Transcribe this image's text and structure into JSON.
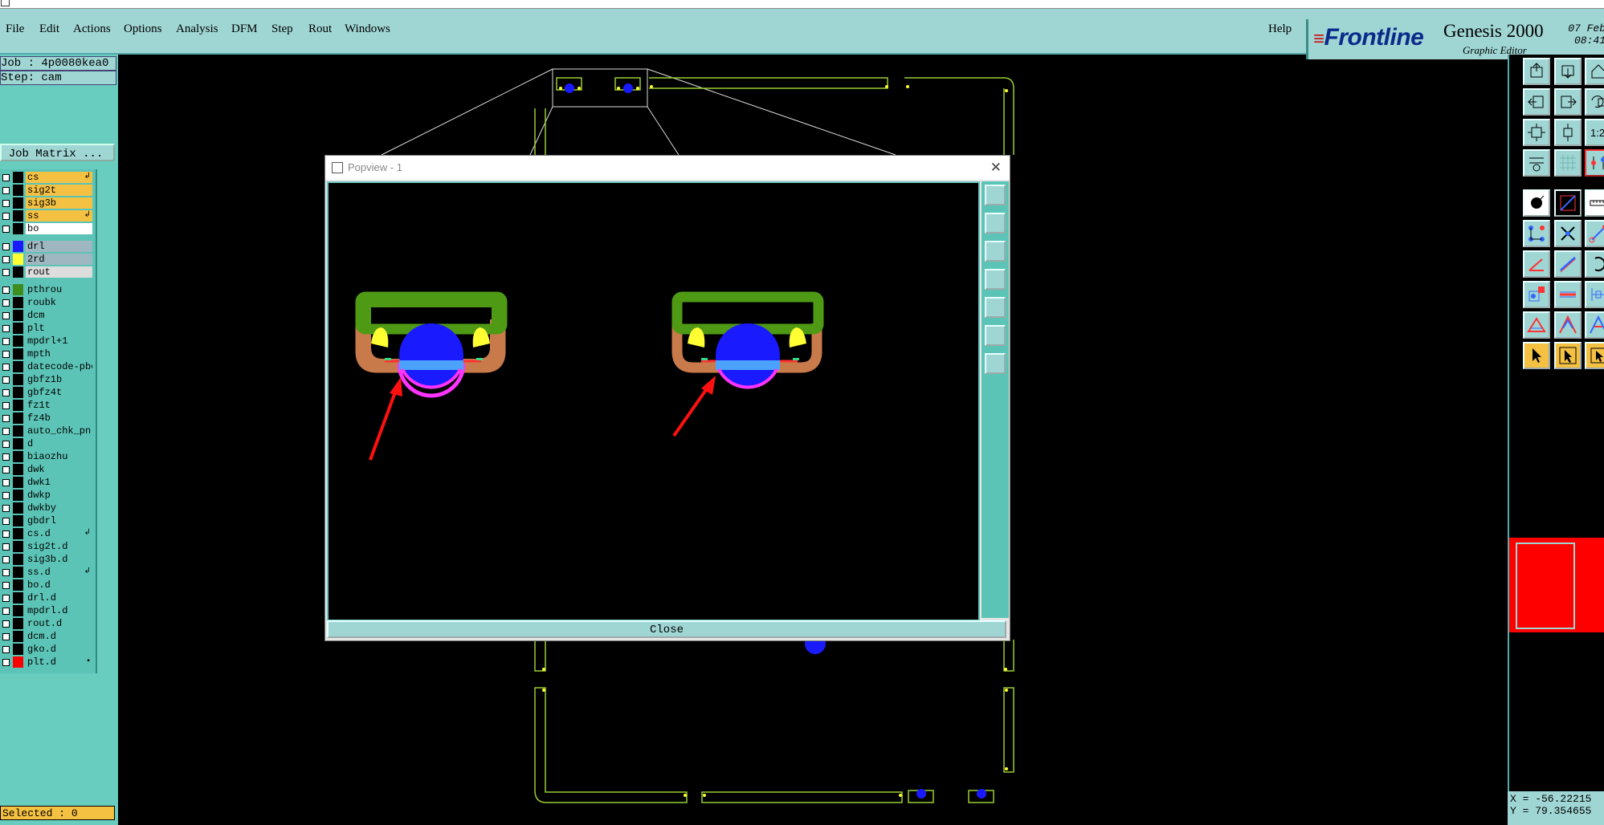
{
  "menu": {
    "items": [
      "File",
      "Edit",
      "Actions",
      "Options",
      "Analysis",
      "DFM",
      "Step",
      "Rout",
      "Windows"
    ],
    "help": "Help"
  },
  "brand": {
    "logo": "Frontline",
    "product": "Genesis 2000",
    "subtitle": "Graphic Editor",
    "date": "07 Feb",
    "time": "08:41"
  },
  "info": {
    "job": "Job : 4p0080kea0",
    "step": "Step: cam",
    "job_matrix": "Job Matrix ..."
  },
  "layers": [
    {
      "name": "cs",
      "swatch": "#000000",
      "label_bg": "#f5c143",
      "mark": "↲"
    },
    {
      "name": "sig2t",
      "swatch": "#000000",
      "label_bg": "#f5c143",
      "mark": ""
    },
    {
      "name": "sig3b",
      "swatch": "#000000",
      "label_bg": "#f5c143",
      "mark": ""
    },
    {
      "name": "ss",
      "swatch": "#000000",
      "label_bg": "#f5c143",
      "mark": "↲"
    },
    {
      "name": "bo",
      "swatch": "#000000",
      "label_bg": "#ffffff",
      "mark": ""
    },
    {
      "name": "drl",
      "swatch": "#1a1aff",
      "label_bg": "#9fb7c0",
      "mark": ""
    },
    {
      "name": "2rd",
      "swatch": "#ffff33",
      "label_bg": "#9fb7c0",
      "mark": ""
    },
    {
      "name": "rout",
      "swatch": "#000000",
      "label_bg": "#dddddd",
      "mark": ""
    },
    {
      "name": "pthrou",
      "swatch": "#3d8c1e",
      "label_bg": "#5cc4b7",
      "mark": ""
    },
    {
      "name": "roubk",
      "swatch": "#000000",
      "label_bg": "#5cc4b7",
      "mark": ""
    },
    {
      "name": "dcm",
      "swatch": "#000000",
      "label_bg": "#5cc4b7",
      "mark": ""
    },
    {
      "name": "plt",
      "swatch": "#000000",
      "label_bg": "#5cc4b7",
      "mark": ""
    },
    {
      "name": "mpdrl+1",
      "swatch": "#000000",
      "label_bg": "#5cc4b7",
      "mark": ""
    },
    {
      "name": "mpth",
      "swatch": "#000000",
      "label_bg": "#5cc4b7",
      "mark": ""
    },
    {
      "name": "datecode-pbe",
      "swatch": "#000000",
      "label_bg": "#5cc4b7",
      "mark": ""
    },
    {
      "name": "gbfz1b",
      "swatch": "#000000",
      "label_bg": "#5cc4b7",
      "mark": ""
    },
    {
      "name": "gbfz4t",
      "swatch": "#000000",
      "label_bg": "#5cc4b7",
      "mark": ""
    },
    {
      "name": "fz1t",
      "swatch": "#000000",
      "label_bg": "#5cc4b7",
      "mark": ""
    },
    {
      "name": "fz4b",
      "swatch": "#000000",
      "label_bg": "#5cc4b7",
      "mark": ""
    },
    {
      "name": "auto_chk_pn",
      "swatch": "#000000",
      "label_bg": "#5cc4b7",
      "mark": ""
    },
    {
      "name": "d",
      "swatch": "#000000",
      "label_bg": "#5cc4b7",
      "mark": ""
    },
    {
      "name": "biaozhu",
      "swatch": "#000000",
      "label_bg": "#5cc4b7",
      "mark": ""
    },
    {
      "name": "dwk",
      "swatch": "#000000",
      "label_bg": "#5cc4b7",
      "mark": ""
    },
    {
      "name": "dwk1",
      "swatch": "#000000",
      "label_bg": "#5cc4b7",
      "mark": ""
    },
    {
      "name": "dwkp",
      "swatch": "#000000",
      "label_bg": "#5cc4b7",
      "mark": ""
    },
    {
      "name": "dwkby",
      "swatch": "#000000",
      "label_bg": "#5cc4b7",
      "mark": ""
    },
    {
      "name": "gbdrl",
      "swatch": "#000000",
      "label_bg": "#5cc4b7",
      "mark": ""
    },
    {
      "name": "cs.d",
      "swatch": "#000000",
      "label_bg": "#5cc4b7",
      "mark": "↲"
    },
    {
      "name": "sig2t.d",
      "swatch": "#000000",
      "label_bg": "#5cc4b7",
      "mark": ""
    },
    {
      "name": "sig3b.d",
      "swatch": "#000000",
      "label_bg": "#5cc4b7",
      "mark": ""
    },
    {
      "name": "ss.d",
      "swatch": "#000000",
      "label_bg": "#5cc4b7",
      "mark": "↲"
    },
    {
      "name": "bo.d",
      "swatch": "#000000",
      "label_bg": "#5cc4b7",
      "mark": ""
    },
    {
      "name": "drl.d",
      "swatch": "#000000",
      "label_bg": "#5cc4b7",
      "mark": ""
    },
    {
      "name": "mpdrl.d",
      "swatch": "#000000",
      "label_bg": "#5cc4b7",
      "mark": ""
    },
    {
      "name": "rout.d",
      "swatch": "#000000",
      "label_bg": "#5cc4b7",
      "mark": ""
    },
    {
      "name": "dcm.d",
      "swatch": "#000000",
      "label_bg": "#5cc4b7",
      "mark": ""
    },
    {
      "name": "gko.d",
      "swatch": "#000000",
      "label_bg": "#5cc4b7",
      "mark": ""
    },
    {
      "name": "plt.d",
      "swatch": "#ff0000",
      "label_bg": "#5cc4b7",
      "mark": "▪"
    }
  ],
  "status": {
    "selected": "Selected : 0",
    "x": "X = -56.22215",
    "y": "Y = 79.354655"
  },
  "popup": {
    "title": "Popview - 1",
    "close": "Close"
  },
  "colors": {
    "panel": "#9fd6d4",
    "panel_dark": "#5cc4b7",
    "copper_green": "#4f9a14",
    "drill_blue": "#1a1aff",
    "pad_yellow": "#ffff33",
    "arrow_red": "#ff1010"
  }
}
